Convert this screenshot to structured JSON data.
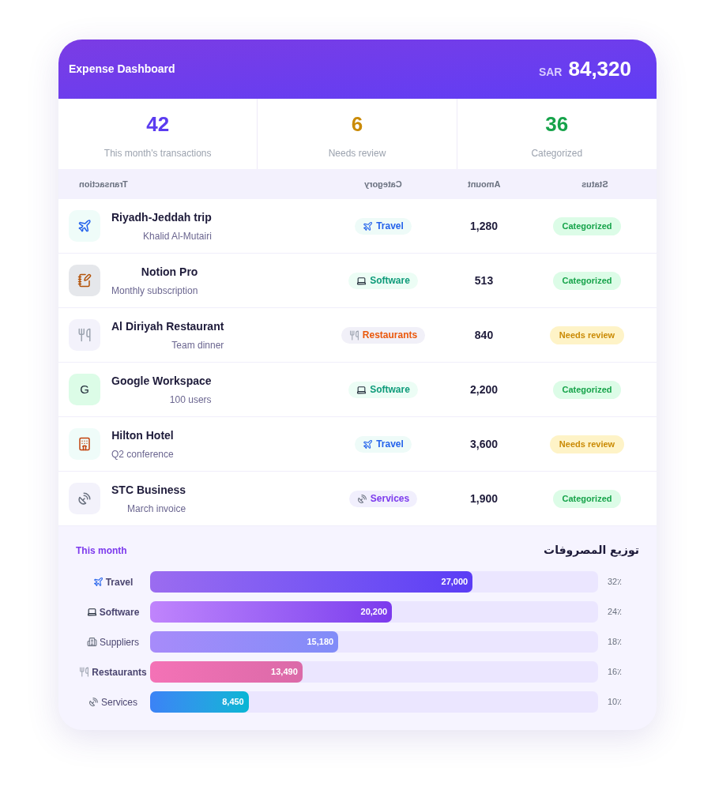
{
  "header": {
    "title": "Expense Dashboard",
    "currency": "SAR",
    "total": "84,320"
  },
  "stats": [
    {
      "value": "42",
      "label": "This month's transactions",
      "color": "#5b3cf0"
    },
    {
      "value": "6",
      "label": "Needs review",
      "color": "#ca8a04"
    },
    {
      "value": "36",
      "label": "Categorized",
      "color": "#16a34a"
    }
  ],
  "table": {
    "columns": [
      "Transaction",
      "Category",
      "Amount",
      "Status"
    ],
    "rows": [
      {
        "kind": "flight",
        "title": "Riyadh-Jeddah trip",
        "subtitle": "Khalid Al-Mutairi",
        "category": {
          "kind": "travel",
          "label": "Travel"
        },
        "amount": "1,280",
        "status": {
          "kind": "categorized",
          "label": "Categorized"
        }
      },
      {
        "kind": "note",
        "title": "Notion Pro",
        "subtitle": "Monthly subscription",
        "category": {
          "kind": "software",
          "label": "Software"
        },
        "amount": "513",
        "status": {
          "kind": "categorized",
          "label": "Categorized"
        }
      },
      {
        "kind": "meal",
        "title": "Al Diriyah Restaurant",
        "subtitle": "Team dinner",
        "category": {
          "kind": "restaurants",
          "label": "Restaurants"
        },
        "amount": "840",
        "status": {
          "kind": "review",
          "label": "Needs review"
        }
      },
      {
        "kind": "letter",
        "letter": "G",
        "title": "Google Workspace",
        "subtitle": "100 users",
        "category": {
          "kind": "software",
          "label": "Software"
        },
        "amount": "2,200",
        "status": {
          "kind": "categorized",
          "label": "Categorized"
        }
      },
      {
        "kind": "hotel",
        "title": "Hilton Hotel",
        "subtitle": "Q2 conference",
        "category": {
          "kind": "travel",
          "label": "Travel"
        },
        "amount": "3,600",
        "status": {
          "kind": "review",
          "label": "Needs review"
        }
      },
      {
        "kind": "telecom",
        "title": "STC Business",
        "subtitle": "March invoice",
        "category": {
          "kind": "services",
          "label": "Services"
        },
        "amount": "1,900",
        "status": {
          "kind": "categorized",
          "label": "Categorized"
        }
      }
    ]
  },
  "breakdown": {
    "period": "This month",
    "title": "توزيع المصروفات",
    "bars": [
      {
        "kind": "travel",
        "label": "Travel",
        "bold": true,
        "value": "27,000",
        "percent": "32٪",
        "level": 0.72
      },
      {
        "kind": "software",
        "label": "Software",
        "bold": true,
        "value": "20,200",
        "percent": "24٪",
        "level": 0.54
      },
      {
        "kind": "suppliers",
        "label": "Suppliers",
        "bold": false,
        "value": "15,180",
        "percent": "18٪",
        "level": 0.42
      },
      {
        "kind": "restaurants",
        "label": "Restaurants",
        "bold": true,
        "value": "13,490",
        "percent": "16٪",
        "level": 0.34
      },
      {
        "kind": "services",
        "label": "Services",
        "bold": false,
        "value": "8,450",
        "percent": "10٪",
        "level": 0.22
      }
    ]
  }
}
